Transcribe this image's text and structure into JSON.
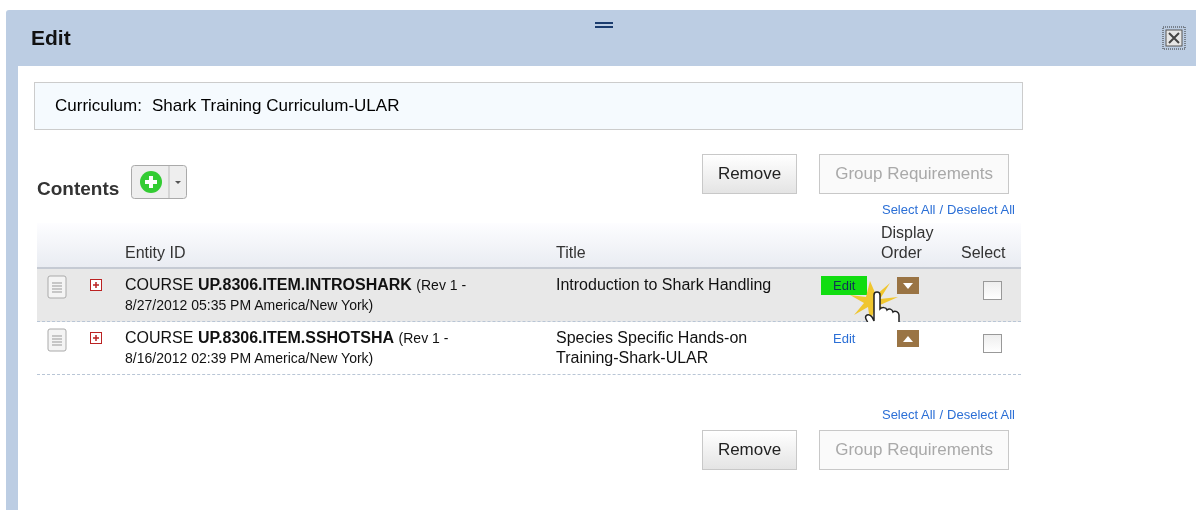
{
  "dialog": {
    "title": "Edit"
  },
  "curriculum": {
    "label": "Curriculum:",
    "value": "Shark Training Curriculum-ULAR"
  },
  "contents": {
    "title": "Contents"
  },
  "top_actions": {
    "buttons": [
      {
        "label": "Remove",
        "disabled": false
      },
      {
        "label": "Group Requirements",
        "disabled": true
      }
    ],
    "select_all": "Select All",
    "separator": "/",
    "deselect_all": "Deselect All"
  },
  "table": {
    "columns": [
      "Entity ID",
      "Title",
      "Display Order",
      "Select"
    ],
    "rows": [
      {
        "type": "COURSE",
        "id": "UP.8306.ITEM.INTROSHARK",
        "revision": "(Rev 1 -",
        "revision_date": "8/27/2012 05:35 PM America/New York)",
        "title": "Introduction to Shark Handling",
        "edit": "Edit",
        "edit_hover": true,
        "selected": true,
        "order": [
          {
            "kind": "down"
          }
        ],
        "checked": false
      },
      {
        "type": "COURSE",
        "id": "UP.8306.ITEM.SSHOTSHA",
        "revision": "(Rev 1 -",
        "revision_date": "8/16/2012 02:39 PM America/New York)",
        "title": "Species Specific Hands-on Training-Shark-ULAR",
        "edit": "Edit",
        "edit_hover": false,
        "selected": false,
        "order": [
          {
            "kind": "up"
          }
        ],
        "checked": false
      }
    ]
  },
  "bottom_actions": {
    "select_all": "Select All",
    "separator": "/",
    "deselect_all": "Deselect All",
    "buttons": [
      {
        "label": "Remove",
        "disabled": false
      },
      {
        "label": "Group Requirements",
        "disabled": true
      }
    ]
  }
}
